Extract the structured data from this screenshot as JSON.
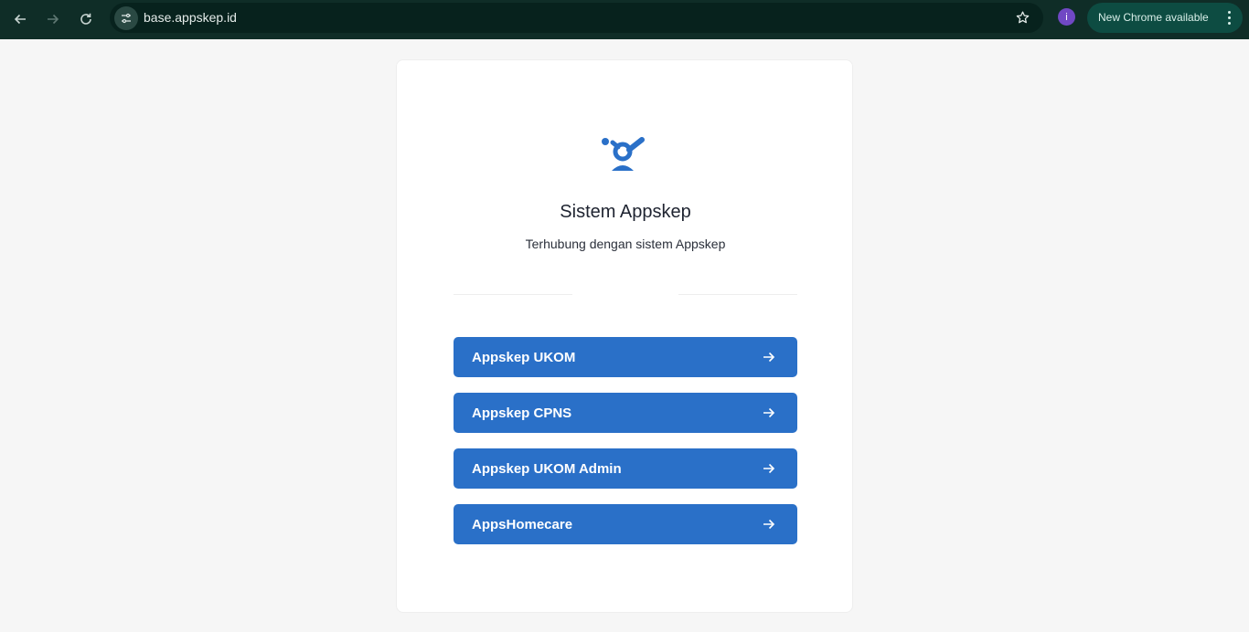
{
  "browser": {
    "url": "base.appskep.id",
    "profile_initial": "i",
    "update_label": "New Chrome available"
  },
  "page": {
    "title": "Sistem Appskep",
    "subtitle": "Terhubung dengan sistem Appskep",
    "apps": [
      {
        "label": "Appskep UKOM"
      },
      {
        "label": "Appskep CPNS"
      },
      {
        "label": "Appskep UKOM Admin"
      },
      {
        "label": "AppsHomecare"
      }
    ]
  },
  "colors": {
    "toolbar": "#0f2d27",
    "accent": "#2a70c8",
    "page_bg": "#f6f6f6"
  }
}
